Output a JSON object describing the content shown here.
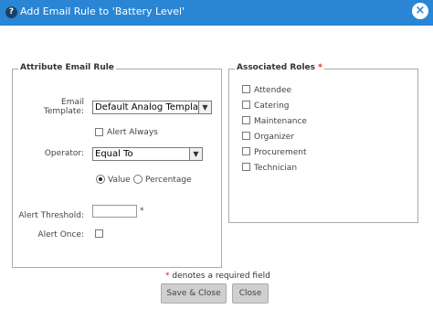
{
  "dialog": {
    "help_glyph": "?",
    "title": "Add Email Rule to 'Battery Level'",
    "close_glyph": "×"
  },
  "attribute_rule": {
    "legend": "Attribute Email Rule",
    "email_template_label_1": "Email",
    "email_template_label_2": "Template:",
    "email_template_value": "Default Analog Template",
    "alert_always_label": "Alert Always",
    "operator_label": "Operator:",
    "operator_value": "Equal To",
    "value_option": "Value",
    "percentage_option": "Percentage",
    "alert_threshold_label": "Alert Threshold:",
    "alert_threshold_value": "",
    "required_star": "*",
    "alert_once_label": "Alert Once:"
  },
  "associated_roles": {
    "legend": "Associated Roles",
    "required_star": "*",
    "roles": [
      {
        "label": "Attendee",
        "checked": false
      },
      {
        "label": "Catering",
        "checked": false
      },
      {
        "label": "Maintenance",
        "checked": false
      },
      {
        "label": "Organizer",
        "checked": false
      },
      {
        "label": "Procurement",
        "checked": false
      },
      {
        "label": "Technician",
        "checked": false
      }
    ]
  },
  "footer": {
    "required_star": "*",
    "required_note": "denotes a required field",
    "save_close_label": "Save & Close",
    "close_label": "Close"
  },
  "icons": {
    "arrow_glyph": "▼"
  }
}
